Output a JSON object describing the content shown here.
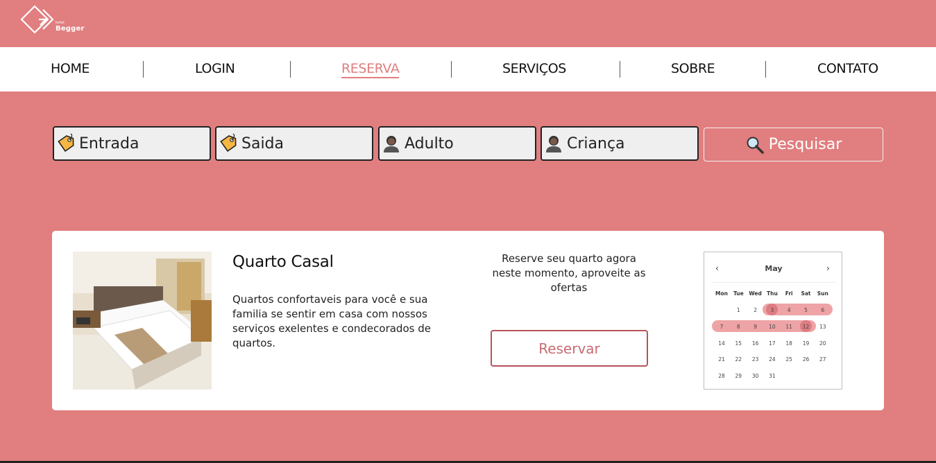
{
  "brand": {
    "small_text": "hotel",
    "name": "Begger"
  },
  "nav": {
    "items": [
      {
        "label": "HOME",
        "active": false
      },
      {
        "label": "LOGIN",
        "active": false
      },
      {
        "label": "RESERVA",
        "active": true
      },
      {
        "label": "SERVIÇOS",
        "active": false
      },
      {
        "label": "SOBRE",
        "active": false
      },
      {
        "label": "CONTATO",
        "active": false
      }
    ]
  },
  "search": {
    "fields": [
      {
        "label": "Entrada",
        "icon": "tag-icon"
      },
      {
        "label": "Saida",
        "icon": "tag-icon"
      },
      {
        "label": "Adulto",
        "icon": "person-icon"
      },
      {
        "label": "Criança",
        "icon": "person-icon"
      }
    ],
    "button_label": "Pesquisar",
    "button_icon": "magnifier-icon"
  },
  "room": {
    "title": "Quarto Casal",
    "description": "Quartos confortaveis para você e sua familia se sentir em casa com nossos serviços exelentes e condecorados de quartos.",
    "promo": "Reserve seu quarto agora neste momento, aproveite as ofertas",
    "reserve_label": "Reservar"
  },
  "calendar": {
    "month": "May",
    "prev": "‹",
    "next": "›",
    "weekdays": [
      "Mon",
      "Tue",
      "Wed",
      "Thu",
      "Fri",
      "Sat",
      "Sun"
    ],
    "weeks": [
      [
        "",
        "1",
        "2",
        "3",
        "4",
        "5",
        "6"
      ],
      [
        "7",
        "8",
        "9",
        "10",
        "11",
        "12",
        "13"
      ],
      [
        "14",
        "15",
        "16",
        "17",
        "18",
        "19",
        "20"
      ],
      [
        "21",
        "22",
        "23",
        "24",
        "25",
        "26",
        "27"
      ],
      [
        "28",
        "29",
        "30",
        "31",
        "",
        "",
        ""
      ]
    ],
    "range_start": "3",
    "range_end": "12"
  },
  "colors": {
    "background": "#e17e7f",
    "accent": "#e17e7f",
    "reserve_border": "#b6525a",
    "range_band": "#eea3a6",
    "range_endpoint": "#dd7c82"
  }
}
